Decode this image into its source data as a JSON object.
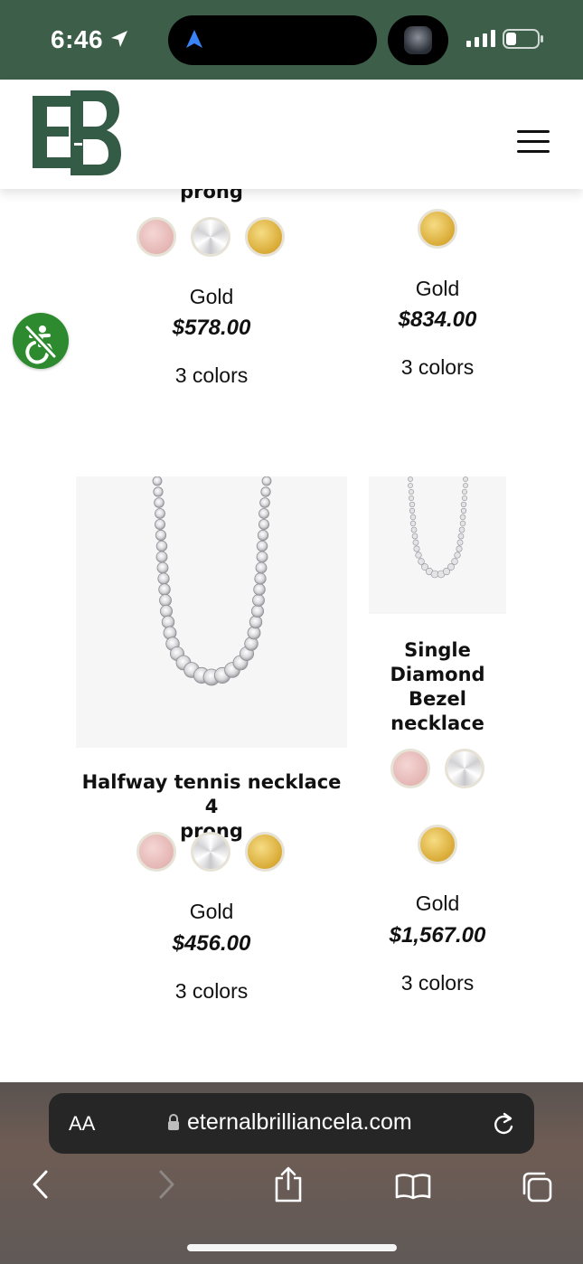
{
  "status": {
    "time": "6:46"
  },
  "header": {
    "logo_text": "EB"
  },
  "products": [
    {
      "title": "prong",
      "metal": "Gold",
      "price": "$578.00",
      "colors": "3 colors"
    },
    {
      "title": "",
      "metal": "Gold",
      "price": "$834.00",
      "colors": "3 colors"
    },
    {
      "title": "Halfway tennis necklace 4 prong",
      "title_line1": "Halfway tennis necklace 4",
      "title_line2": "prong",
      "metal": "Gold",
      "price": "$456.00",
      "colors": "3 colors"
    },
    {
      "title": "Single Diamond Bezel necklace",
      "title_lines": [
        "Single",
        "Diamond",
        "Bezel",
        "necklace"
      ],
      "metal": "Gold",
      "price": "$1,567.00",
      "colors": "3 colors"
    }
  ],
  "swatch_colors": {
    "rose": "#e3b3b1",
    "white": "#d8d8dc",
    "gold": "#d9aa35"
  },
  "theme": {
    "brand_green": "#3d5e48",
    "a11y_green": "#2e8a2e"
  },
  "browser": {
    "aa_label": "AA",
    "url": "eternalbrilliancela.com"
  }
}
